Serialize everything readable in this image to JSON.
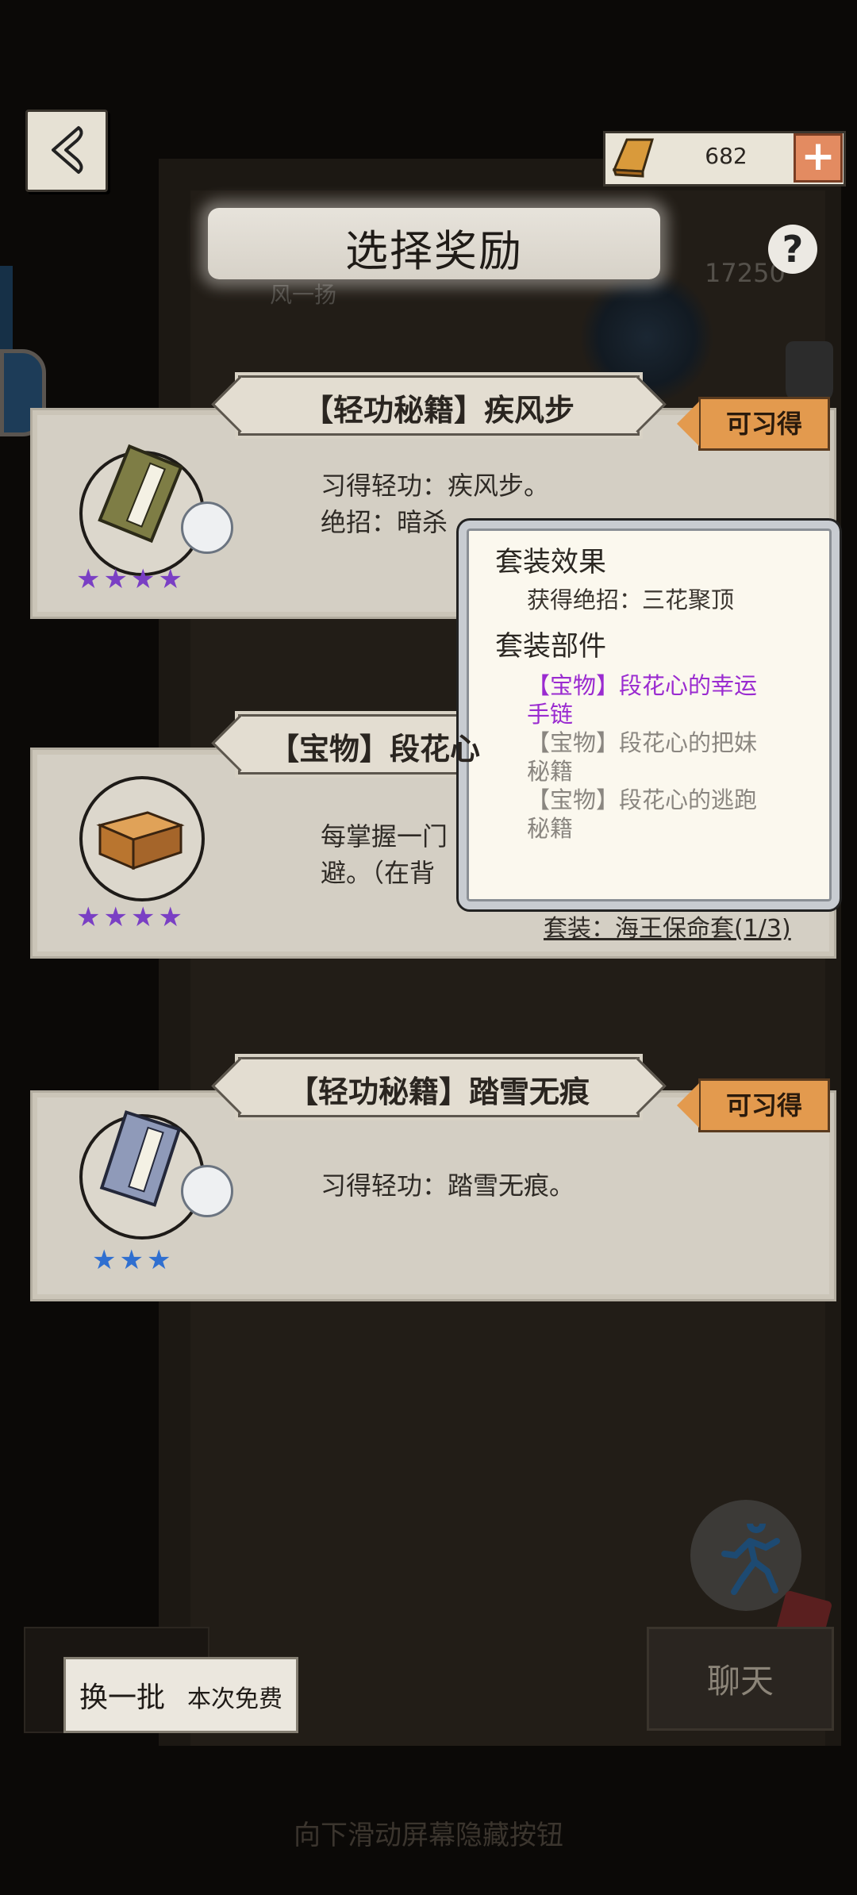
{
  "header": {
    "title": "选择奖励",
    "currency_value": "682",
    "faint_counter": "17250",
    "faint_name": "风一扬"
  },
  "cards": [
    {
      "title": "【轻功秘籍】疾风步",
      "tag": "可习得",
      "desc_lines": [
        "习得轻功：疾风步。",
        "绝招：暗杀"
      ],
      "stars": "★★★★",
      "star_color": "#7a3fc4"
    },
    {
      "title": "【宝物】段花心",
      "desc_lines": [
        "每掌握一门",
        "避。（在背"
      ],
      "stars": "★★★★",
      "star_color": "#7a3fc4",
      "set_label": "套装：海王保命套(1/3)"
    },
    {
      "title": "【轻功秘籍】踏雪无痕",
      "tag": "可习得",
      "desc_lines": [
        "习得轻功：踏雪无痕。"
      ],
      "stars": "★★★",
      "star_color": "#2f6fd0"
    }
  ],
  "tooltip": {
    "set_effect_heading": "套装效果",
    "set_effect_text": "获得绝招：三花聚顶",
    "set_parts_heading": "套装部件",
    "parts": [
      {
        "line1": "【宝物】段花心的幸运",
        "line2": "手链",
        "owned": true
      },
      {
        "line1": "【宝物】段花心的把妹",
        "line2": "秘籍",
        "owned": false
      },
      {
        "line1": "【宝物】段花心的逃跑",
        "line2": "秘籍",
        "owned": false
      }
    ]
  },
  "footer": {
    "refresh_label": "换一批",
    "refresh_sub": "本次免费",
    "chat_label": "聊天",
    "hint": "向下滑动屏幕隐藏按钮"
  },
  "colors": {
    "accent_tag": "#e39a4e",
    "purple_star": "#7a3fc4",
    "blue_star": "#2f6fd0",
    "owned_part": "#9a2bd0"
  },
  "icons": {
    "back": "back-arrow-icon",
    "gold": "gold-ingot-icon",
    "plus": "plus-icon",
    "help": "help-icon",
    "skill": "boot-skill-icon",
    "run": "running-man-icon"
  }
}
